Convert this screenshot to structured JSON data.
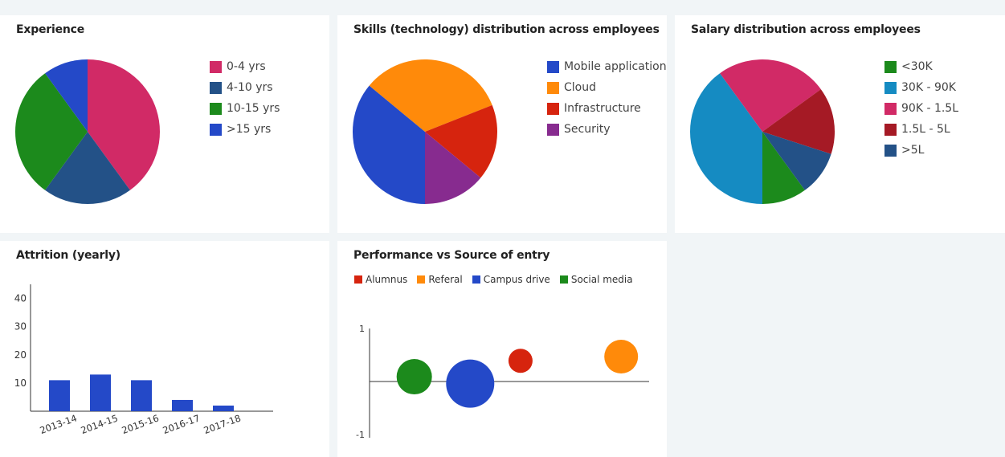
{
  "cards": {
    "experience": {
      "title": "Experience"
    },
    "skills": {
      "title": "Skills (technology) distribution across employees"
    },
    "salary": {
      "title": "Salary distribution across employees"
    },
    "attrition": {
      "title": "Attrition (yearly)"
    },
    "performance": {
      "title": "Performance vs Source of entry"
    }
  },
  "chart_data": [
    {
      "id": "experience",
      "type": "pie",
      "title": "Experience",
      "slices": [
        {
          "label": "0-4 yrs",
          "value": 40,
          "color": "#d12a66"
        },
        {
          "label": "4-10 yrs",
          "value": 20,
          "color": "#235187"
        },
        {
          "label": "10-15 yrs",
          "value": 30,
          "color": "#1c8a1c"
        },
        {
          "label": ">15 yrs",
          "value": 10,
          "color": "#2449c8"
        }
      ],
      "start": "0-4 yrs at top, clockwise",
      "legend": "right"
    },
    {
      "id": "skills",
      "type": "pie",
      "title": "Skills (technology) distribution across employees",
      "slices": [
        {
          "label": "Mobile application",
          "value": 36,
          "color": "#2449c8"
        },
        {
          "label": "Cloud",
          "value": 33,
          "color": "#ff8a0a"
        },
        {
          "label": "Infrastructure",
          "value": 17,
          "color": "#d6240e"
        },
        {
          "label": "Security",
          "value": 14,
          "color": "#872b8f"
        }
      ],
      "legend": "right"
    },
    {
      "id": "salary",
      "type": "pie",
      "title": "Salary distribution across employees",
      "slices": [
        {
          "label": "<30K",
          "value": 10,
          "color": "#1c8a1c"
        },
        {
          "label": "30K - 90K",
          "value": 40,
          "color": "#158bc2"
        },
        {
          "label": "90K - 1.5L",
          "value": 25,
          "color": "#d12a66"
        },
        {
          "label": "1.5L - 5L",
          "value": 15,
          "color": "#a51a25"
        },
        {
          "label": ">5L",
          "value": 10,
          "color": "#235187"
        }
      ],
      "legend": "right"
    },
    {
      "id": "attrition",
      "type": "bar",
      "title": "Attrition (yearly)",
      "categories": [
        "2013-14",
        "2014-15",
        "2015-16",
        "2016-17",
        "2017-18"
      ],
      "values": [
        11,
        13,
        11,
        4,
        2
      ],
      "color": "#2449c8",
      "ylim": [
        0,
        45
      ],
      "yticks": [
        10,
        20,
        30,
        40
      ]
    },
    {
      "id": "performance",
      "type": "scatter",
      "title": "Performance vs Source of entry",
      "legend": "top",
      "series": [
        {
          "name": "Alumnus",
          "color": "#d6240e"
        },
        {
          "name": "Referal",
          "color": "#ff8a0a"
        },
        {
          "name": "Campus drive",
          "color": "#2449c8"
        },
        {
          "name": "Social media",
          "color": "#1c8a1c"
        }
      ],
      "points": [
        {
          "series": "Alumnus",
          "x": 0.54,
          "y": 0.39,
          "size": 0.3
        },
        {
          "series": "Referal",
          "x": 0.9,
          "y": 0.47,
          "size": 0.42
        },
        {
          "series": "Campus drive",
          "x": 0.36,
          "y": -0.04,
          "size": 0.6
        },
        {
          "series": "Social media",
          "x": 0.16,
          "y": 0.09,
          "size": 0.44
        }
      ],
      "xlim": [
        0,
        1
      ],
      "ylim": [
        -1,
        1
      ],
      "yticks": [
        "1",
        "-1"
      ]
    }
  ]
}
